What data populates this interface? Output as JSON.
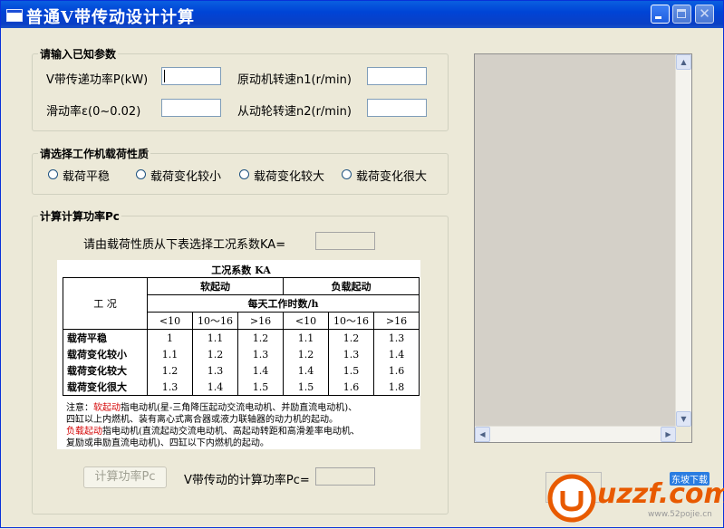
{
  "window": {
    "title": "普通V带传动设计计算"
  },
  "known_params": {
    "legend": "请输入已知参数",
    "power_label": "V带传递功率P(kW)",
    "n1_label": "原动机转速n1(r/min)",
    "slip_label": "滑动率ε(0~0.02)",
    "n2_label": "从动轮转速n2(r/min)"
  },
  "load": {
    "legend": "请选择工作机载荷性质",
    "options": [
      "载荷平稳",
      "载荷变化较小",
      "载荷变化较大",
      "载荷变化很大"
    ]
  },
  "calc": {
    "legend": "计算计算功率Pc",
    "ka_prompt": "请由载荷性质从下表选择工况系数KA=",
    "button": "计算功率Pc",
    "result_label": "V带传动的计算功率Pc="
  },
  "ka_table": {
    "caption": "工况系数 KA",
    "work_label": "工  况",
    "soft_start": "软起动",
    "load_start": "负载起动",
    "hours_label": "每天工作时数/h",
    "hours": [
      "<10",
      "10～16",
      ">16",
      "<10",
      "10～16",
      ">16"
    ],
    "rows": [
      {
        "name": "载荷平稳",
        "values": [
          "1",
          "1.1",
          "1.2",
          "1.1",
          "1.2",
          "1.3"
        ]
      },
      {
        "name": "载荷变化较小",
        "values": [
          "1.1",
          "1.2",
          "1.3",
          "1.2",
          "1.3",
          "1.4"
        ]
      },
      {
        "name": "载荷变化较大",
        "values": [
          "1.2",
          "1.3",
          "1.4",
          "1.4",
          "1.5",
          "1.6"
        ]
      },
      {
        "name": "载荷变化很大",
        "values": [
          "1.3",
          "1.4",
          "1.5",
          "1.5",
          "1.6",
          "1.8"
        ]
      }
    ],
    "note": {
      "prefix": "注意：",
      "soft_term": "软起动",
      "soft_text": "指电动机(星-三角降压起动交流电动机、并励直流电动机)、",
      "soft_text2": "四缸以上内燃机、装有离心式离合器或液力联轴器的动力机的起动。",
      "load_term": "负载起动",
      "load_text": "指电动机(直流起动交流电动机、高起动转距和高滑差率电动机、",
      "load_text2": "复励或串励直流电动机)、四缸以下内燃机的起动。"
    }
  },
  "watermark": {
    "brand": "uzzf.com",
    "tag": "东坡下载",
    "url": "www.52pojie.cn"
  },
  "colors": {
    "title_bar": "#0a3fc5",
    "dialog_bg": "#ece9d8",
    "note_red": "#d40000",
    "watermark_orange": "#e85a00"
  },
  "icons": [
    "app-icon",
    "minimize-icon",
    "maximize-icon",
    "close-icon",
    "scroll-up-arrow-icon",
    "scroll-down-arrow-icon",
    "scroll-left-arrow-icon",
    "scroll-right-arrow-icon",
    "watermark-logo-icon"
  ]
}
